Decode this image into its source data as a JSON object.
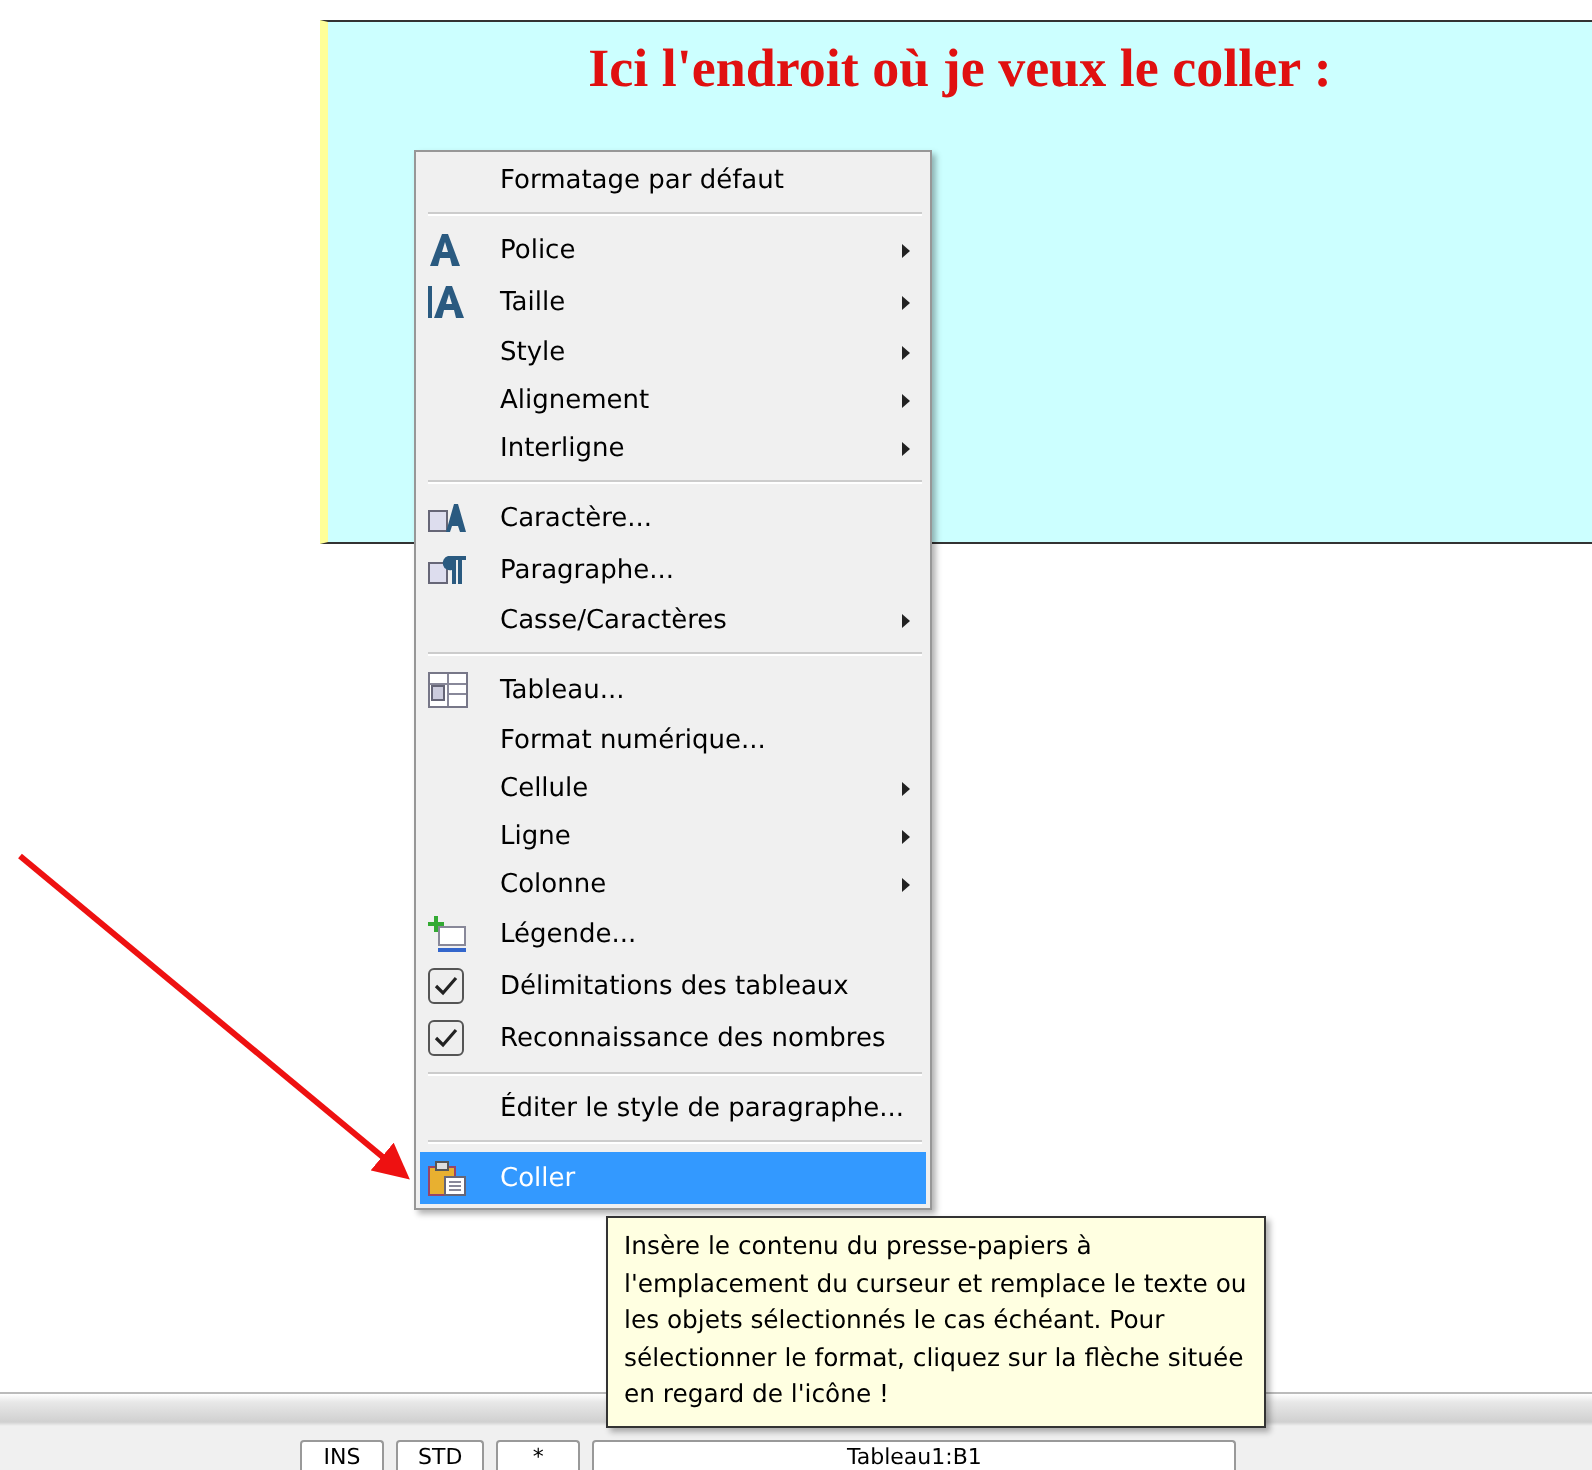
{
  "document": {
    "heading": "Ici l'endroit où je veux le coller :"
  },
  "context_menu": {
    "items": [
      {
        "kind": "item",
        "label": "Formatage par défaut",
        "submenu": false,
        "selected": false
      },
      {
        "kind": "separator"
      },
      {
        "kind": "item",
        "label": "Police",
        "submenu": true,
        "selected": false
      },
      {
        "kind": "item",
        "label": "Taille",
        "submenu": true,
        "selected": false
      },
      {
        "kind": "item",
        "label": "Style",
        "submenu": true,
        "selected": false
      },
      {
        "kind": "item",
        "label": "Alignement",
        "submenu": true,
        "selected": false
      },
      {
        "kind": "item",
        "label": "Interligne",
        "submenu": true,
        "selected": false
      },
      {
        "kind": "separator"
      },
      {
        "kind": "item",
        "label": "Caractère...",
        "submenu": false,
        "selected": false
      },
      {
        "kind": "item",
        "label": "Paragraphe...",
        "submenu": false,
        "selected": false
      },
      {
        "kind": "item",
        "label": "Casse/Caractères",
        "submenu": true,
        "selected": false
      },
      {
        "kind": "separator"
      },
      {
        "kind": "item",
        "label": "Tableau...",
        "submenu": false,
        "selected": false
      },
      {
        "kind": "item",
        "label": "Format numérique...",
        "submenu": false,
        "selected": false
      },
      {
        "kind": "item",
        "label": "Cellule",
        "submenu": true,
        "selected": false
      },
      {
        "kind": "item",
        "label": "Ligne",
        "submenu": true,
        "selected": false
      },
      {
        "kind": "item",
        "label": "Colonne",
        "submenu": true,
        "selected": false
      },
      {
        "kind": "item",
        "label": "Légende...",
        "submenu": false,
        "selected": false
      },
      {
        "kind": "check",
        "label": "Délimitations des tableaux",
        "checked": true,
        "selected": false
      },
      {
        "kind": "check",
        "label": "Reconnaissance des nombres",
        "checked": true,
        "selected": false
      },
      {
        "kind": "separator"
      },
      {
        "kind": "item",
        "label": "Éditer le style de paragraphe...",
        "submenu": false,
        "selected": false
      },
      {
        "kind": "separator"
      },
      {
        "kind": "item",
        "label": "Coller",
        "submenu": false,
        "selected": true
      }
    ]
  },
  "tooltip": {
    "text": "Insère le contenu du presse-papiers à l'emplacement du curseur et remplace le texte ou les objets sélectionnés le cas échéant. Pour sélectionner le format, cliquez sur la flèche située en regard de l'icône !"
  },
  "status_bar": {
    "fields": [
      "INS",
      "STD",
      "*",
      "Tableau1:B1"
    ]
  }
}
